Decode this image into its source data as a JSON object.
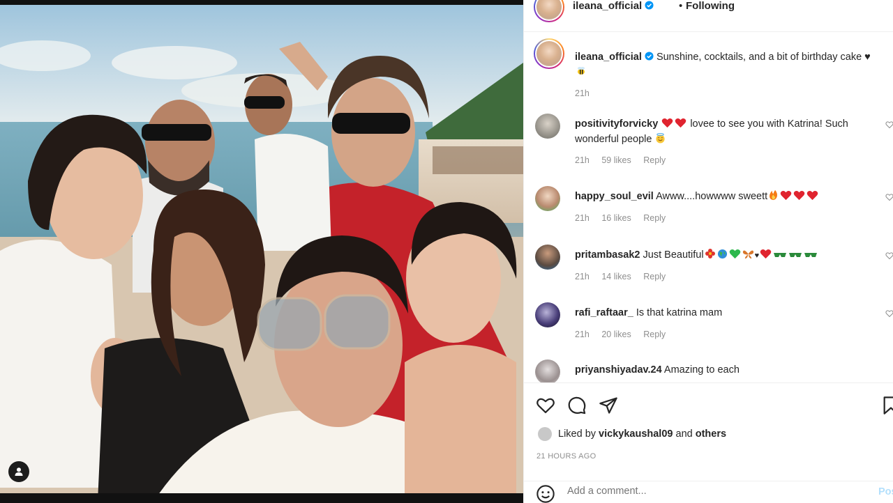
{
  "post": {
    "author": "ileana_official",
    "follow_separator": "•",
    "follow_state": "Following"
  },
  "caption": {
    "username": "ileana_official",
    "text": "Sunshine, cocktails, and a bit of birthday cake ♥",
    "time": "21h"
  },
  "comments": [
    {
      "username": "positivityforvicky",
      "text": "lovee to see you with Katrina! Such wonderful people",
      "time": "21h",
      "likes": "59 likes",
      "reply": "Reply"
    },
    {
      "username": "happy_soul_evil",
      "text": "Awww....howwww sweett",
      "time": "21h",
      "likes": "16 likes",
      "reply": "Reply"
    },
    {
      "username": "pritambasak2",
      "text": "Just Beautiful",
      "time": "21h",
      "likes": "14 likes",
      "reply": "Reply"
    },
    {
      "username": "rafi_raftaar_",
      "text": "Is that katrina mam",
      "time": "21h",
      "likes": "20 likes",
      "reply": "Reply"
    },
    {
      "username": "priyanshiyadav.24",
      "text": "Amazing to each",
      "time": "",
      "likes": "",
      "reply": ""
    }
  ],
  "likes_line": {
    "prefix": "Liked by",
    "user": "vickykaushal09",
    "and": "and",
    "others": "others"
  },
  "post_age": "21 HOURS AGO",
  "add_comment": {
    "placeholder": "Add a comment...",
    "post_label": "Post"
  },
  "icons": [
    "heart-icon",
    "comment-icon",
    "share-icon",
    "bookmark-icon",
    "emoji-icon",
    "user-tag-icon",
    "verified-badge-icon"
  ],
  "colors": {
    "heart_red": "#ed4956",
    "verified_blue": "#0095f6",
    "secondary_text": "#8e8e8e",
    "post_link": "#b2dffc"
  }
}
